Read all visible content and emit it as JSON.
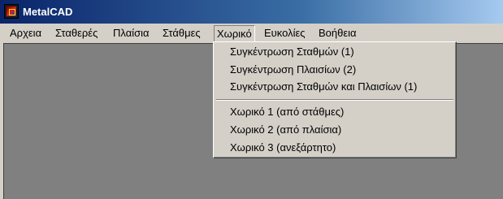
{
  "window": {
    "title": "MetalCAD",
    "icon": "app-icon"
  },
  "menubar": {
    "items": [
      {
        "label": "Αρχεια"
      },
      {
        "label": "Σταθερές"
      },
      {
        "label": "Πλαίσια"
      },
      {
        "label": "Στάθμες"
      },
      {
        "label": "Χωρικό"
      },
      {
        "label": "Ευκολίες"
      },
      {
        "label": "Βοήθεια"
      }
    ],
    "open_menu": "Χωρικό"
  },
  "dropdown": {
    "items": [
      {
        "label": "Συγκέντρωση Σταθμών (1)"
      },
      {
        "label": "Συγκέντρωση Πλαισίων (2)"
      },
      {
        "label": "Συγκέντρωση Σταθμών και Πλαισίων (1)"
      },
      {
        "label": "Χωρικό 1 (από στάθμες)"
      },
      {
        "label": "Χωρικό 2 (από πλαίσια)"
      },
      {
        "label": "Χωρικό 3 (ανεξάρτητο)"
      }
    ]
  }
}
